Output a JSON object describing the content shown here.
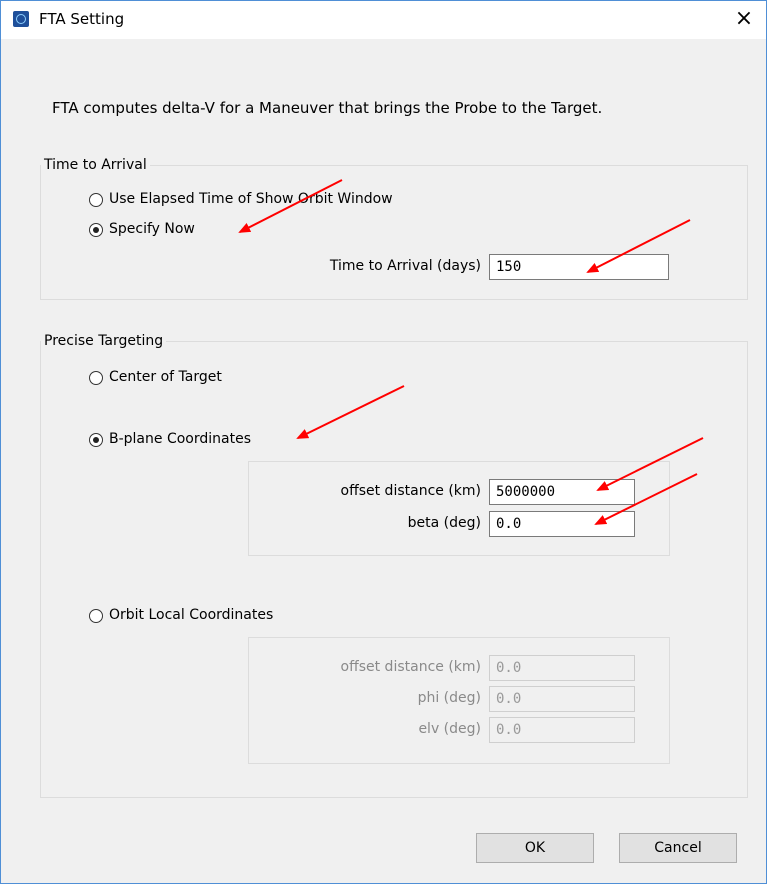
{
  "window": {
    "title": "FTA Setting",
    "close_glyph": "×",
    "icon": "app-orbit-icon"
  },
  "description": "FTA computes delta-V for a Maneuver that brings the Probe to the Target.",
  "time_to_arrival": {
    "group_label": "Time to Arrival",
    "options": [
      {
        "label": "Use Elapsed Time of Show Orbit Window",
        "checked": false
      },
      {
        "label": "Specify Now",
        "checked": true
      }
    ],
    "field_label": "Time to Arrival (days)",
    "field_value": "150"
  },
  "precise_targeting": {
    "group_label": "Precise Targeting",
    "center_label": "Center of Target",
    "bplane": {
      "label": "B-plane Coordinates",
      "checked": true,
      "offset_label": "offset distance (km)",
      "offset_value": "5000000",
      "beta_label": "beta (deg)",
      "beta_value": "0.0"
    },
    "orbit_local": {
      "label": "Orbit Local Coordinates",
      "checked": false,
      "offset_label": "offset distance (km)",
      "offset_value": "0.0",
      "phi_label": "phi (deg)",
      "phi_value": "0.0",
      "elv_label": "elv (deg)",
      "elv_value": "0.0"
    }
  },
  "buttons": {
    "ok": "OK",
    "cancel": "Cancel"
  },
  "annotation_color": "#ff0000"
}
